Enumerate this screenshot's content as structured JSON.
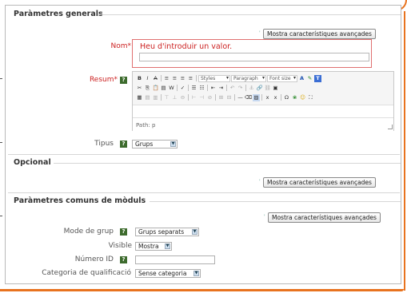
{
  "sections": {
    "general": {
      "title": "Paràmetres generals",
      "advanced_button": "Mostra característiques avançades",
      "name_label": "Nom",
      "name_error": "Heu d'introduir un valor.",
      "summary_label": "Resum",
      "type_label": "Tipus",
      "type_value": "Grups"
    },
    "optional": {
      "title": "Opcional",
      "advanced_button": "Mostra característiques avançades"
    },
    "common": {
      "title": "Paràmetres comuns de mòduls",
      "advanced_button": "Mostra característiques avançades",
      "group_mode_label": "Mode de grup",
      "group_mode_value": "Grups separats",
      "visible_label": "Visible",
      "visible_value": "Mostra",
      "id_number_label": "Número ID",
      "id_number_value": "",
      "grade_category_label": "Categoria de qualificació",
      "grade_category_value": "Sense categoria"
    }
  },
  "editor": {
    "styles_select": "Styles",
    "paragraph_select": "Paragraph",
    "fontsize_select": "Font size",
    "path_text": "Path: p"
  },
  "common": {
    "required_marker": "*",
    "help_glyph": "?"
  },
  "colors": {
    "accent_orange": "#e8731f",
    "error_red": "#cc2222",
    "help_green": "#3d6b2d"
  }
}
